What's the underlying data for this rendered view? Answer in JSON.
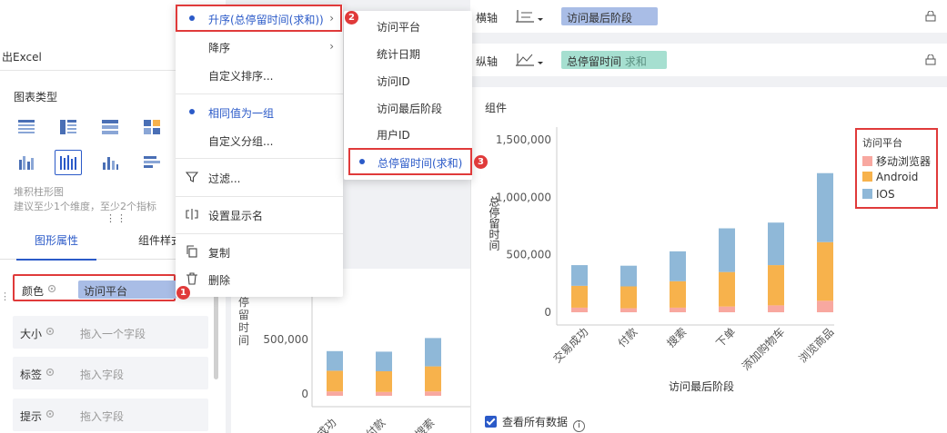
{
  "left_panel": {
    "export_label": "出Excel",
    "chart_type_title": "图表类型",
    "chart_type_desc": "堆积柱形图",
    "chart_type_hint": "建议至少1个维度，至少2个指标",
    "dots": "⋮⋮",
    "tabs": [
      "图形属性",
      "组件样式"
    ],
    "props": [
      {
        "label": "颜色",
        "value": "访问平台"
      },
      {
        "label": "大小",
        "placeholder": "拖入一个字段"
      },
      {
        "label": "标签",
        "placeholder": "拖入字段"
      },
      {
        "label": "提示",
        "placeholder": "拖入字段"
      }
    ],
    "side_dots": "⋮"
  },
  "axis_bar": {
    "x_axis_label": "横轴",
    "x_field": "访问最后阶段",
    "y_axis_label": "纵轴",
    "y_field": "总停留时间",
    "y_field_agg": "求和"
  },
  "main_menu": {
    "items": [
      {
        "label": "升序(总停留时间(求和))",
        "selected": true,
        "has_submenu": true
      },
      {
        "label": "降序",
        "has_submenu": true
      },
      {
        "label": "自定义排序..."
      },
      {
        "label": "相同值为一组",
        "selected": true
      },
      {
        "label": "自定义分组..."
      },
      {
        "label": "过滤..."
      },
      {
        "label": "设置显示名"
      },
      {
        "label": "复制"
      },
      {
        "label": "删除"
      }
    ]
  },
  "sub_menu": {
    "items": [
      "访问平台",
      "统计日期",
      "访问ID",
      "访问最后阶段",
      "用户ID",
      "总停留时间(求和)"
    ],
    "selected_index": 5
  },
  "badges": [
    "1",
    "2",
    "3"
  ],
  "mid_chart": {
    "ylabel": "停留时间",
    "ticks": [
      "500,000",
      "0"
    ],
    "categories": [
      "成功",
      "付款",
      "搜索"
    ]
  },
  "right_panel": {
    "group_label": "组件",
    "view_all_label": "查看所有数据",
    "info_icon": "i"
  },
  "colors": {
    "mobile": "#f8a8a0",
    "android": "#f7b24c",
    "ios": "#8fb8d8",
    "accent": "#2b5ac8",
    "highlight": "#e03a3a"
  },
  "chart_data": {
    "type": "bar",
    "stacked": true,
    "title": "",
    "xlabel": "访问最后阶段",
    "ylabel": "总停留时间",
    "legend_title": "访问平台",
    "legend_position": "top-right",
    "categories": [
      "交易成功",
      "付款",
      "搜索",
      "下单",
      "添加购物车",
      "浏览商品"
    ],
    "series": [
      {
        "name": "移动浏览器",
        "values": [
          40000,
          35000,
          40000,
          50000,
          60000,
          100000
        ]
      },
      {
        "name": "Android",
        "values": [
          190000,
          190000,
          230000,
          300000,
          350000,
          510000
        ]
      },
      {
        "name": "IOS",
        "values": [
          180000,
          180000,
          260000,
          380000,
          370000,
          600000
        ]
      }
    ],
    "y_ticks": [
      "1,500,000",
      "1,000,000",
      "500,000",
      "0"
    ],
    "ylim": [
      0,
      1600000
    ],
    "grid": false
  }
}
